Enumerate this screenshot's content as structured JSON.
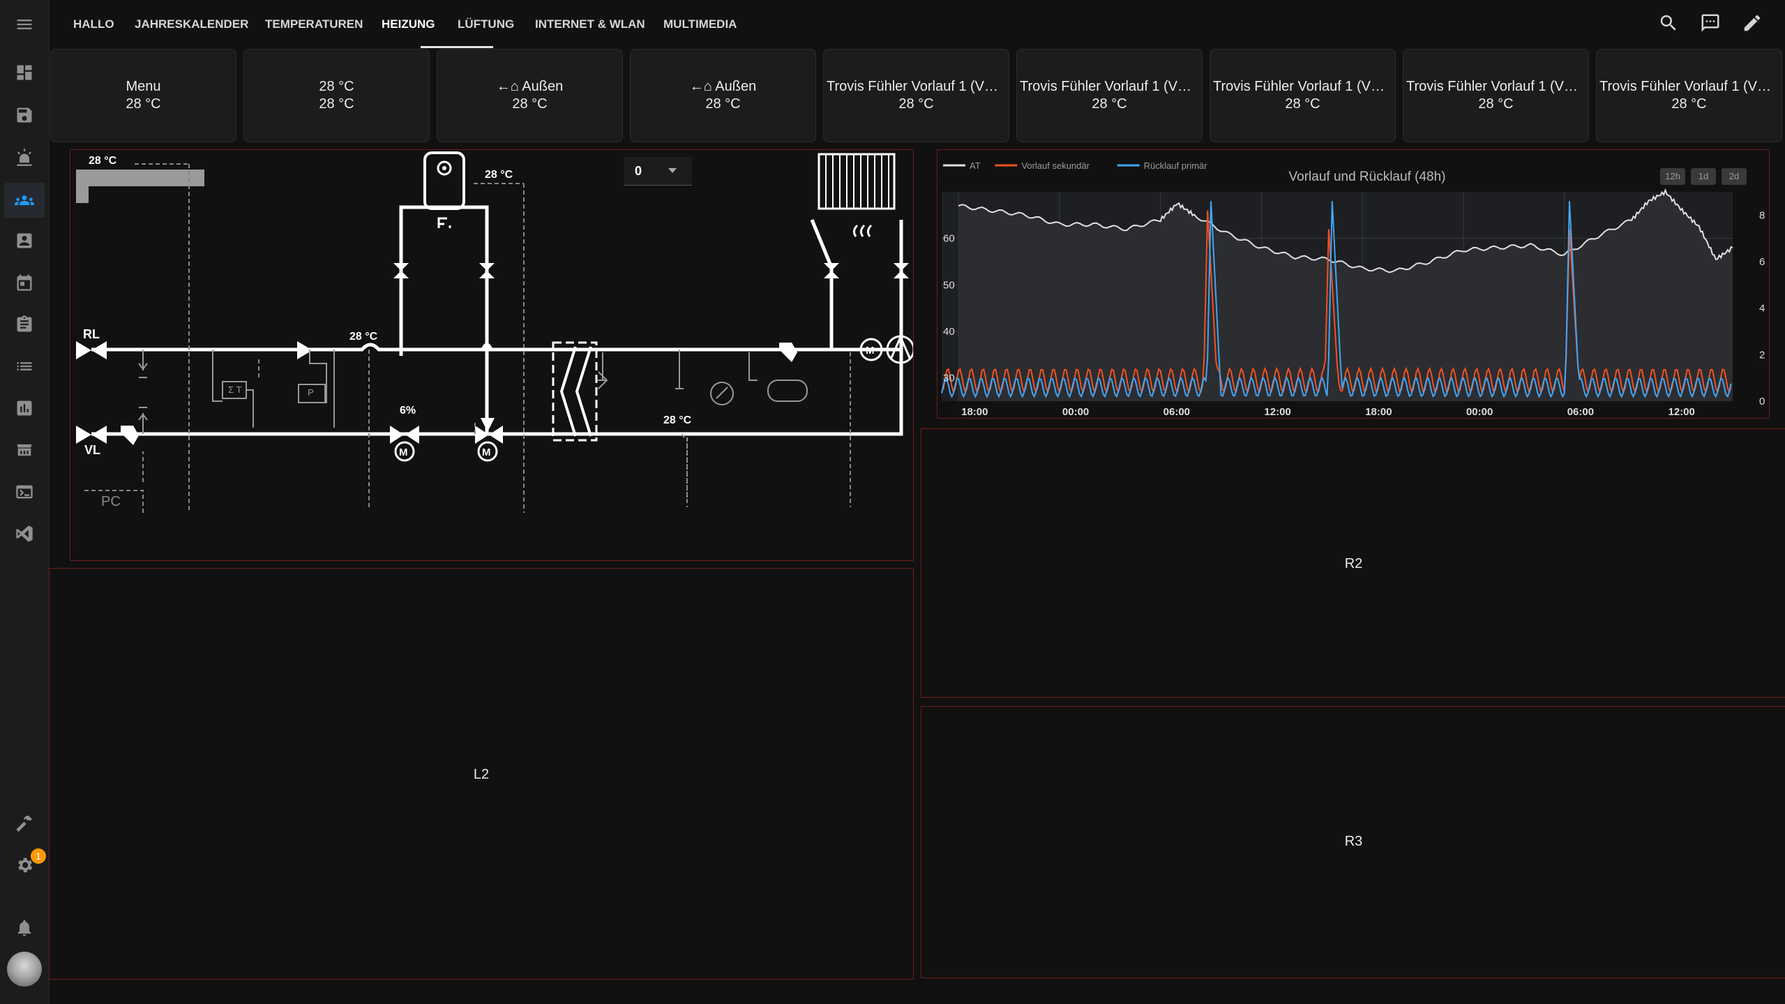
{
  "header": {
    "tabs": [
      {
        "label": "Hallo"
      },
      {
        "label": "Jahreskalender"
      },
      {
        "label": "Temperaturen"
      },
      {
        "label": "Heizung",
        "active": true
      },
      {
        "label": "Lüftung"
      },
      {
        "label": "Internet & WLAN"
      },
      {
        "label": "Multimedia"
      }
    ],
    "icons": [
      "search-icon",
      "chat-icon",
      "pencil-icon"
    ]
  },
  "sidebar": {
    "icons": [
      "menu-icon",
      "dashboard-icon",
      "storage-icon",
      "alarm-light-icon",
      "people-icon",
      "account-box-icon",
      "calendar-icon",
      "clipboard-icon",
      "list-icon",
      "chart-icon",
      "hacs-icon",
      "terminal-icon",
      "vscode-icon",
      "hammer-icon",
      "settings-icon",
      "bell-icon"
    ],
    "settings_badge": "1",
    "active": "people-icon"
  },
  "cards": [
    {
      "line1": "Menu",
      "line2": "28 °C"
    },
    {
      "line1": "28 °C",
      "line2": "28 °C"
    },
    {
      "line1": "←⌂ Außen",
      "line2": "28 °C"
    },
    {
      "line1": "←⌂ Außen",
      "line2": "28 °C"
    },
    {
      "line1": "Trovis Fühler Vorlauf 1 (VF…",
      "line2": "28 °C"
    },
    {
      "line1": "Trovis Fühler Vorlauf 1 (VF…",
      "line2": "28 °C"
    },
    {
      "line1": "Trovis Fühler Vorlauf 1 (VF…",
      "line2": "28 °C"
    },
    {
      "line1": "Trovis Fühler Vorlauf 1 (VF…",
      "line2": "28 °C"
    },
    {
      "line1": "Trovis Fühler Vorlauf 1 (VF…",
      "line2": "28 °C"
    }
  ],
  "schematic": {
    "temp_outdoor": "28 °C",
    "temp_storage": "28 °C",
    "temp_return_line": "28 °C",
    "temp_supply_line": "28 °C",
    "valve_position": "6%",
    "select_value": "0",
    "label_rl": "RL",
    "label_vl": "VL",
    "label_pc": "PC",
    "sigma_label": "Σ T",
    "p_label": "P",
    "m_label": "M"
  },
  "panels": {
    "l2": "L2",
    "r2": "R2",
    "r3": "R3"
  },
  "chart_data": {
    "type": "line",
    "title": "Vorlauf und Rücklauf (48h)",
    "legend_position": "top-left",
    "range_buttons": [
      "12h",
      "1d",
      "2d"
    ],
    "x_ticks": [
      "18:00",
      "00:00",
      "06:00",
      "12:00",
      "18:00",
      "00:00",
      "06:00",
      "12:00"
    ],
    "y_left_ticks": [
      30,
      40,
      50,
      60
    ],
    "y_right_ticks": [
      0,
      2,
      4,
      6,
      8
    ],
    "grid": true,
    "series": [
      {
        "name": "AT",
        "color": "#e0e0e0",
        "axis": "right",
        "x": [
          0,
          2,
          4,
          6,
          8,
          10,
          12,
          13,
          14,
          16,
          18,
          20,
          22,
          24,
          26,
          28,
          30,
          32,
          34,
          36,
          38,
          40,
          41,
          42,
          43,
          44,
          45,
          46
        ],
        "values": [
          8.4,
          8.2,
          8.0,
          7.6,
          7.6,
          7.4,
          7.8,
          8.5,
          8.0,
          7.2,
          6.6,
          6.2,
          6.1,
          5.7,
          5.6,
          6.0,
          6.5,
          6.6,
          6.7,
          6.3,
          7.1,
          7.8,
          8.6,
          9.0,
          8.2,
          7.5,
          6.1,
          6.6
        ]
      },
      {
        "name": "Vorlauf sekundär",
        "color": "#f4511e",
        "axis": "left",
        "baseline": [
          27,
          32
        ],
        "peaks": [
          {
            "x": 14.8,
            "y": 66
          },
          {
            "x": 22.0,
            "y": 62
          },
          {
            "x": 36.3,
            "y": 62
          }
        ]
      },
      {
        "name": "Rücklauf primär",
        "color": "#42a5f5",
        "axis": "left",
        "baseline": [
          26,
          30
        ],
        "peaks": [
          {
            "x": 15.0,
            "y": 68
          },
          {
            "x": 22.2,
            "y": 68
          },
          {
            "x": 36.3,
            "y": 68
          }
        ]
      }
    ],
    "x_unit": "hours since first tick (18:00)",
    "xlim": [
      -1,
      46
    ],
    "ylim_left": [
      25,
      70
    ],
    "ylim_right": [
      0,
      9
    ]
  }
}
